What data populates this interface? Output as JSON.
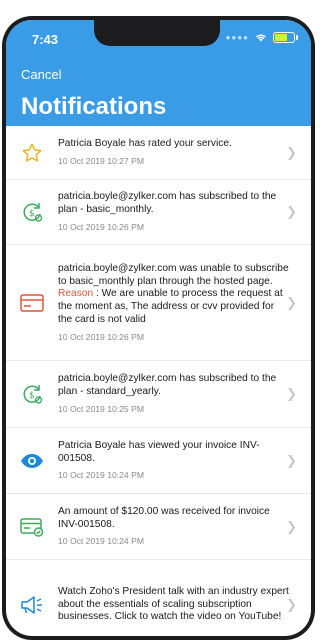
{
  "status_bar": {
    "time": "7:43"
  },
  "header": {
    "cancel_label": "Cancel",
    "title": "Notifications"
  },
  "notifications": [
    {
      "icon": "star-icon",
      "text": "Patricia Boyale has rated your service.",
      "date": "10 Oct 2019 10:27 PM"
    },
    {
      "icon": "subscription-icon",
      "text": "patricia.boyle@zylker.com has subscribed to the plan - basic_monthly.",
      "date": "10 Oct 2019 10:26 PM"
    },
    {
      "icon": "card-icon",
      "text": "patricia.boyle@zylker.com was unable to subscribe to basic_monthly plan through the hosted page.",
      "reason_label": "Reason",
      "reason_text": " : We are unable to process the request at the moment as, The address or cvv provided for the card is not valid",
      "date": "10 Oct 2019 10:26 PM"
    },
    {
      "icon": "subscription-icon",
      "text": "patricia.boyle@zylker.com has subscribed to the plan - standard_yearly.",
      "date": "10 Oct 2019 10:25 PM"
    },
    {
      "icon": "eye-icon",
      "text": "Patricia Boyale has viewed your invoice INV-001508.",
      "date": "10 Oct 2019 10:24 PM"
    },
    {
      "icon": "payment-received-icon",
      "text": "An amount of $120.00 was received for invoice INV-001508.",
      "date": "10 Oct 2019 10:24 PM"
    },
    {
      "icon": "megaphone-icon",
      "text": "Watch Zoho's President talk with an industry expert about the essentials of scaling subscription businesses. Click to watch the video on YouTube!",
      "date": ""
    }
  ],
  "colors": {
    "header": "#3a9be6",
    "star": "#f2b01e",
    "green": "#3aaa5c",
    "red": "#e0533b",
    "blue": "#1e88d6"
  }
}
